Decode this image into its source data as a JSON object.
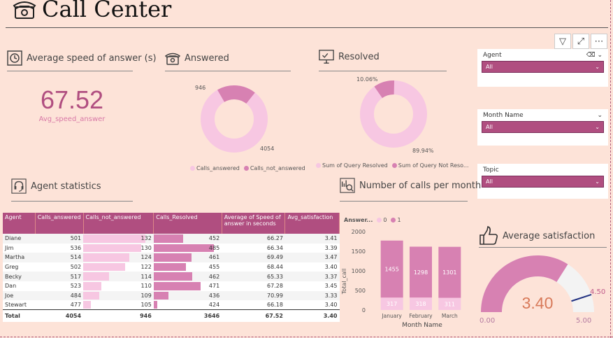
{
  "header": {
    "title": "Call Center",
    "icon": "telephone-icon"
  },
  "toolbar": {
    "filter_icon": "▽",
    "focus_icon": "⤢",
    "more_icon": "⋯"
  },
  "kpi_speed": {
    "title": "Average speed of answer (s)",
    "value": "67.52",
    "label": "Avg_speed_answer"
  },
  "answered": {
    "title": "Answered",
    "label_not_answered": "946",
    "label_answered": "4054",
    "legend": [
      "Calls_answered",
      "Calls_not_answered"
    ],
    "colors": {
      "answered": "#f7c7e2",
      "not_answered": "#d781b2"
    }
  },
  "resolved": {
    "title": "Resolved",
    "label_not_resolved": "10.06%",
    "label_resolved": "89.94%",
    "legend": [
      "Sum of Query Resolved",
      "Sum of Query Not Reso..."
    ]
  },
  "slicers": [
    {
      "title": "Agent",
      "value": "All"
    },
    {
      "title": "Month Name",
      "value": "All"
    },
    {
      "title": "Topic",
      "value": "All"
    }
  ],
  "agent_stats": {
    "title": "Agent statistics",
    "columns": [
      "Agent",
      "Calls_answered",
      "Calls_not_answered",
      "Calls_Resolved",
      "Average of Speed of answer in seconds",
      "Avg_satisfaction"
    ],
    "rows": [
      {
        "agent": "Diane",
        "ans": "501",
        "not": "132",
        "res": "452",
        "speed": "66.27",
        "sat": "3.41"
      },
      {
        "agent": "Jim",
        "ans": "536",
        "not": "130",
        "res": "485",
        "speed": "66.34",
        "sat": "3.39"
      },
      {
        "agent": "Martha",
        "ans": "514",
        "not": "124",
        "res": "461",
        "speed": "69.49",
        "sat": "3.47"
      },
      {
        "agent": "Greg",
        "ans": "502",
        "not": "122",
        "res": "455",
        "speed": "68.44",
        "sat": "3.40"
      },
      {
        "agent": "Becky",
        "ans": "517",
        "not": "114",
        "res": "462",
        "speed": "65.33",
        "sat": "3.37"
      },
      {
        "agent": "Dan",
        "ans": "523",
        "not": "110",
        "res": "471",
        "speed": "67.28",
        "sat": "3.45"
      },
      {
        "agent": "Joe",
        "ans": "484",
        "not": "109",
        "res": "436",
        "speed": "70.99",
        "sat": "3.33"
      },
      {
        "agent": "Stewart",
        "ans": "477",
        "not": "105",
        "res": "424",
        "speed": "66.18",
        "sat": "3.40"
      }
    ],
    "total": {
      "agent": "Total",
      "ans": "4054",
      "not": "946",
      "res": "3646",
      "speed": "67.52",
      "sat": "3.40"
    },
    "bar_colors": {
      "not": "#f7c7e2",
      "res": "#d781b2"
    }
  },
  "calls_per_month": {
    "title": "Number of calls per month",
    "legend_title": "Answer...",
    "legend": [
      "0",
      "1"
    ],
    "ylabel": "Total_call",
    "xlabel": "Month Name",
    "yticks": [
      "2000",
      "1500",
      "1000",
      "500",
      "0"
    ]
  },
  "satisfaction": {
    "title": "Average satisfaction",
    "value": "3.40",
    "min": "0.00",
    "max": "5.00",
    "target": "4.50"
  },
  "chart_data": [
    {
      "type": "pie",
      "title": "Answered",
      "categories": [
        "Calls_answered",
        "Calls_not_answered"
      ],
      "values": [
        4054,
        946
      ]
    },
    {
      "type": "pie",
      "title": "Resolved",
      "categories": [
        "Sum of Query Resolved",
        "Sum of Query Not Resolved"
      ],
      "values": [
        89.94,
        10.06
      ]
    },
    {
      "type": "bar",
      "title": "Number of calls per month",
      "categories": [
        "January",
        "February",
        "March"
      ],
      "series": [
        {
          "name": "0",
          "values": [
            317,
            318,
            311
          ]
        },
        {
          "name": "1",
          "values": [
            1455,
            1298,
            1301
          ]
        }
      ],
      "xlabel": "Month Name",
      "ylabel": "Total_call",
      "ylim": [
        0,
        2000
      ]
    }
  ]
}
